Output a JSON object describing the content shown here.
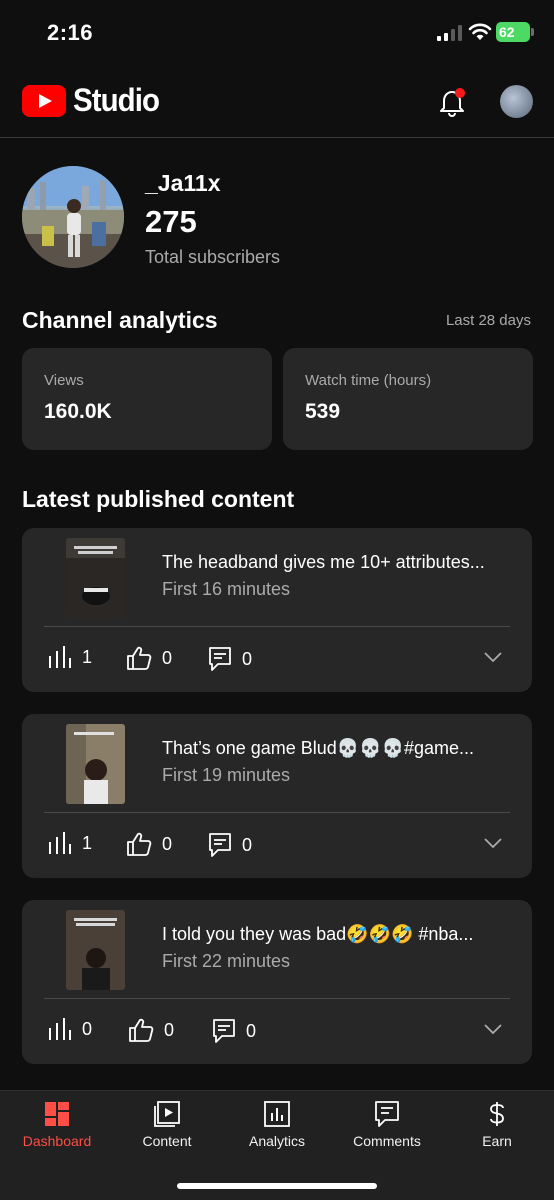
{
  "status_bar": {
    "time": "2:16",
    "battery": "62"
  },
  "header": {
    "logo_text": "Studio"
  },
  "profile": {
    "channel_name": "_Ja11x",
    "subscriber_count": "275",
    "subscriber_label": "Total subscribers"
  },
  "analytics": {
    "title": "Channel analytics",
    "range": "Last 28 days",
    "cards": [
      {
        "label": "Views",
        "value": "160.0K"
      },
      {
        "label": "Watch time (hours)",
        "value": "539"
      }
    ]
  },
  "latest": {
    "title": "Latest published content",
    "items": [
      {
        "title": "The headband gives me 10+ attributes...",
        "subtitle": "First 16 minutes",
        "views": "1",
        "likes": "0",
        "comments": "0"
      },
      {
        "title": "That’s one game Blud💀💀💀#game...",
        "subtitle": "First 19 minutes",
        "views": "1",
        "likes": "0",
        "comments": "0"
      },
      {
        "title": "I told you they was bad🤣🤣🤣 #nba...",
        "subtitle": "First 22 minutes",
        "views": "0",
        "likes": "0",
        "comments": "0"
      }
    ]
  },
  "bottom_nav": [
    {
      "label": "Dashboard",
      "icon": "dashboard-icon",
      "active": true
    },
    {
      "label": "Content",
      "icon": "content-icon",
      "active": false
    },
    {
      "label": "Analytics",
      "icon": "analytics-icon",
      "active": false
    },
    {
      "label": "Comments",
      "icon": "comments-icon",
      "active": false
    },
    {
      "label": "Earn",
      "icon": "dollar-icon",
      "active": false
    }
  ],
  "colors": {
    "background": "#0f0f0f",
    "card": "#272727",
    "accent": "#ff0000",
    "active_nav": "#ff4e45",
    "secondary_text": "#aaaaaa"
  }
}
